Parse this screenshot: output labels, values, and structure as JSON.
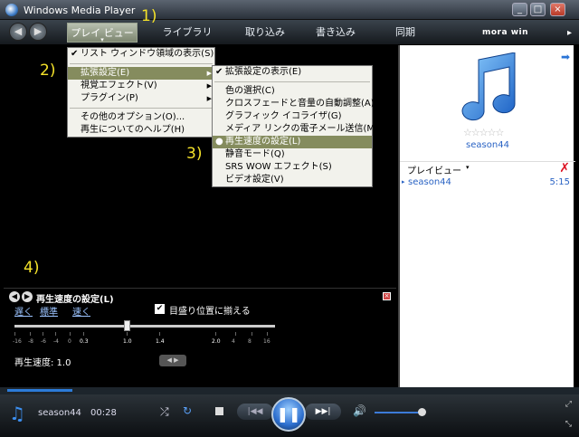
{
  "window": {
    "title": "Windows Media Player",
    "min": "_",
    "max": "□",
    "close": "×"
  },
  "nav": {
    "back": "◀",
    "forward": "▶",
    "tabs": [
      "プレイ ビュー",
      "ライブラリ",
      "取り込み",
      "書き込み",
      "同期"
    ],
    "active_caret": "▾",
    "logo": "mora win",
    "expand": "▸"
  },
  "annotations": [
    "1)",
    "2)",
    "3)",
    "4)"
  ],
  "menu_main": {
    "items": [
      {
        "label": "リスト ウィンドウ領域の表示(S)",
        "check": "✔"
      },
      {
        "label": "拡張設定(E)",
        "sub": "▶"
      },
      {
        "label": "視覚エフェクト(V)",
        "sub": "▶"
      },
      {
        "label": "プラグイン(P)",
        "sub": "▶"
      },
      {
        "label": "その他のオプション(O)..."
      },
      {
        "label": "再生についてのヘルプ(H)"
      }
    ]
  },
  "menu_enh": {
    "items": [
      {
        "label": "拡張設定の表示(E)",
        "check": "✔"
      },
      {
        "label": "色の選択(C)"
      },
      {
        "label": "クロスフェードと音量の自動調整(A)"
      },
      {
        "label": "グラフィック イコライザ(G)"
      },
      {
        "label": "メディア リンクの電子メール送信(M)"
      },
      {
        "label": "再生速度の設定(L)",
        "check": "●"
      },
      {
        "label": "静音モード(Q)"
      },
      {
        "label": "SRS WOW エフェクト(S)"
      },
      {
        "label": "ビデオ設定(V)"
      }
    ]
  },
  "speed": {
    "close": "×",
    "prev": "◀",
    "next": "▶",
    "title": "再生速度の設定(L)",
    "slow": "遅く",
    "normal": "標準",
    "fast": "速く",
    "snap_check": "✔",
    "snap_label": "目盛り位置に揃える",
    "ticks": [
      "-16",
      "-8",
      "-6",
      "-4",
      "0",
      "0.3",
      "1.0",
      "1.4",
      "2.0",
      "4",
      "8",
      "16"
    ],
    "value_label": "再生速度: 1.0",
    "steps": "◀ ▶"
  },
  "list": {
    "arrow": "➡",
    "stars": "☆☆☆☆☆",
    "album": "season44",
    "header": "プレイビュー",
    "header_caret": "▾",
    "delete": "✗",
    "items": [
      {
        "marker": "▸",
        "title": "season44",
        "duration": "5:15"
      }
    ]
  },
  "player": {
    "np_icon": "♫",
    "title": "season44",
    "time": "00:28",
    "shuffle": "⤮",
    "repeat": "↻",
    "prev": "|◀◀",
    "play": "❚❚",
    "next": "▶▶|",
    "mute": "🔊",
    "expand": "⤢",
    "compact": "⤡"
  }
}
